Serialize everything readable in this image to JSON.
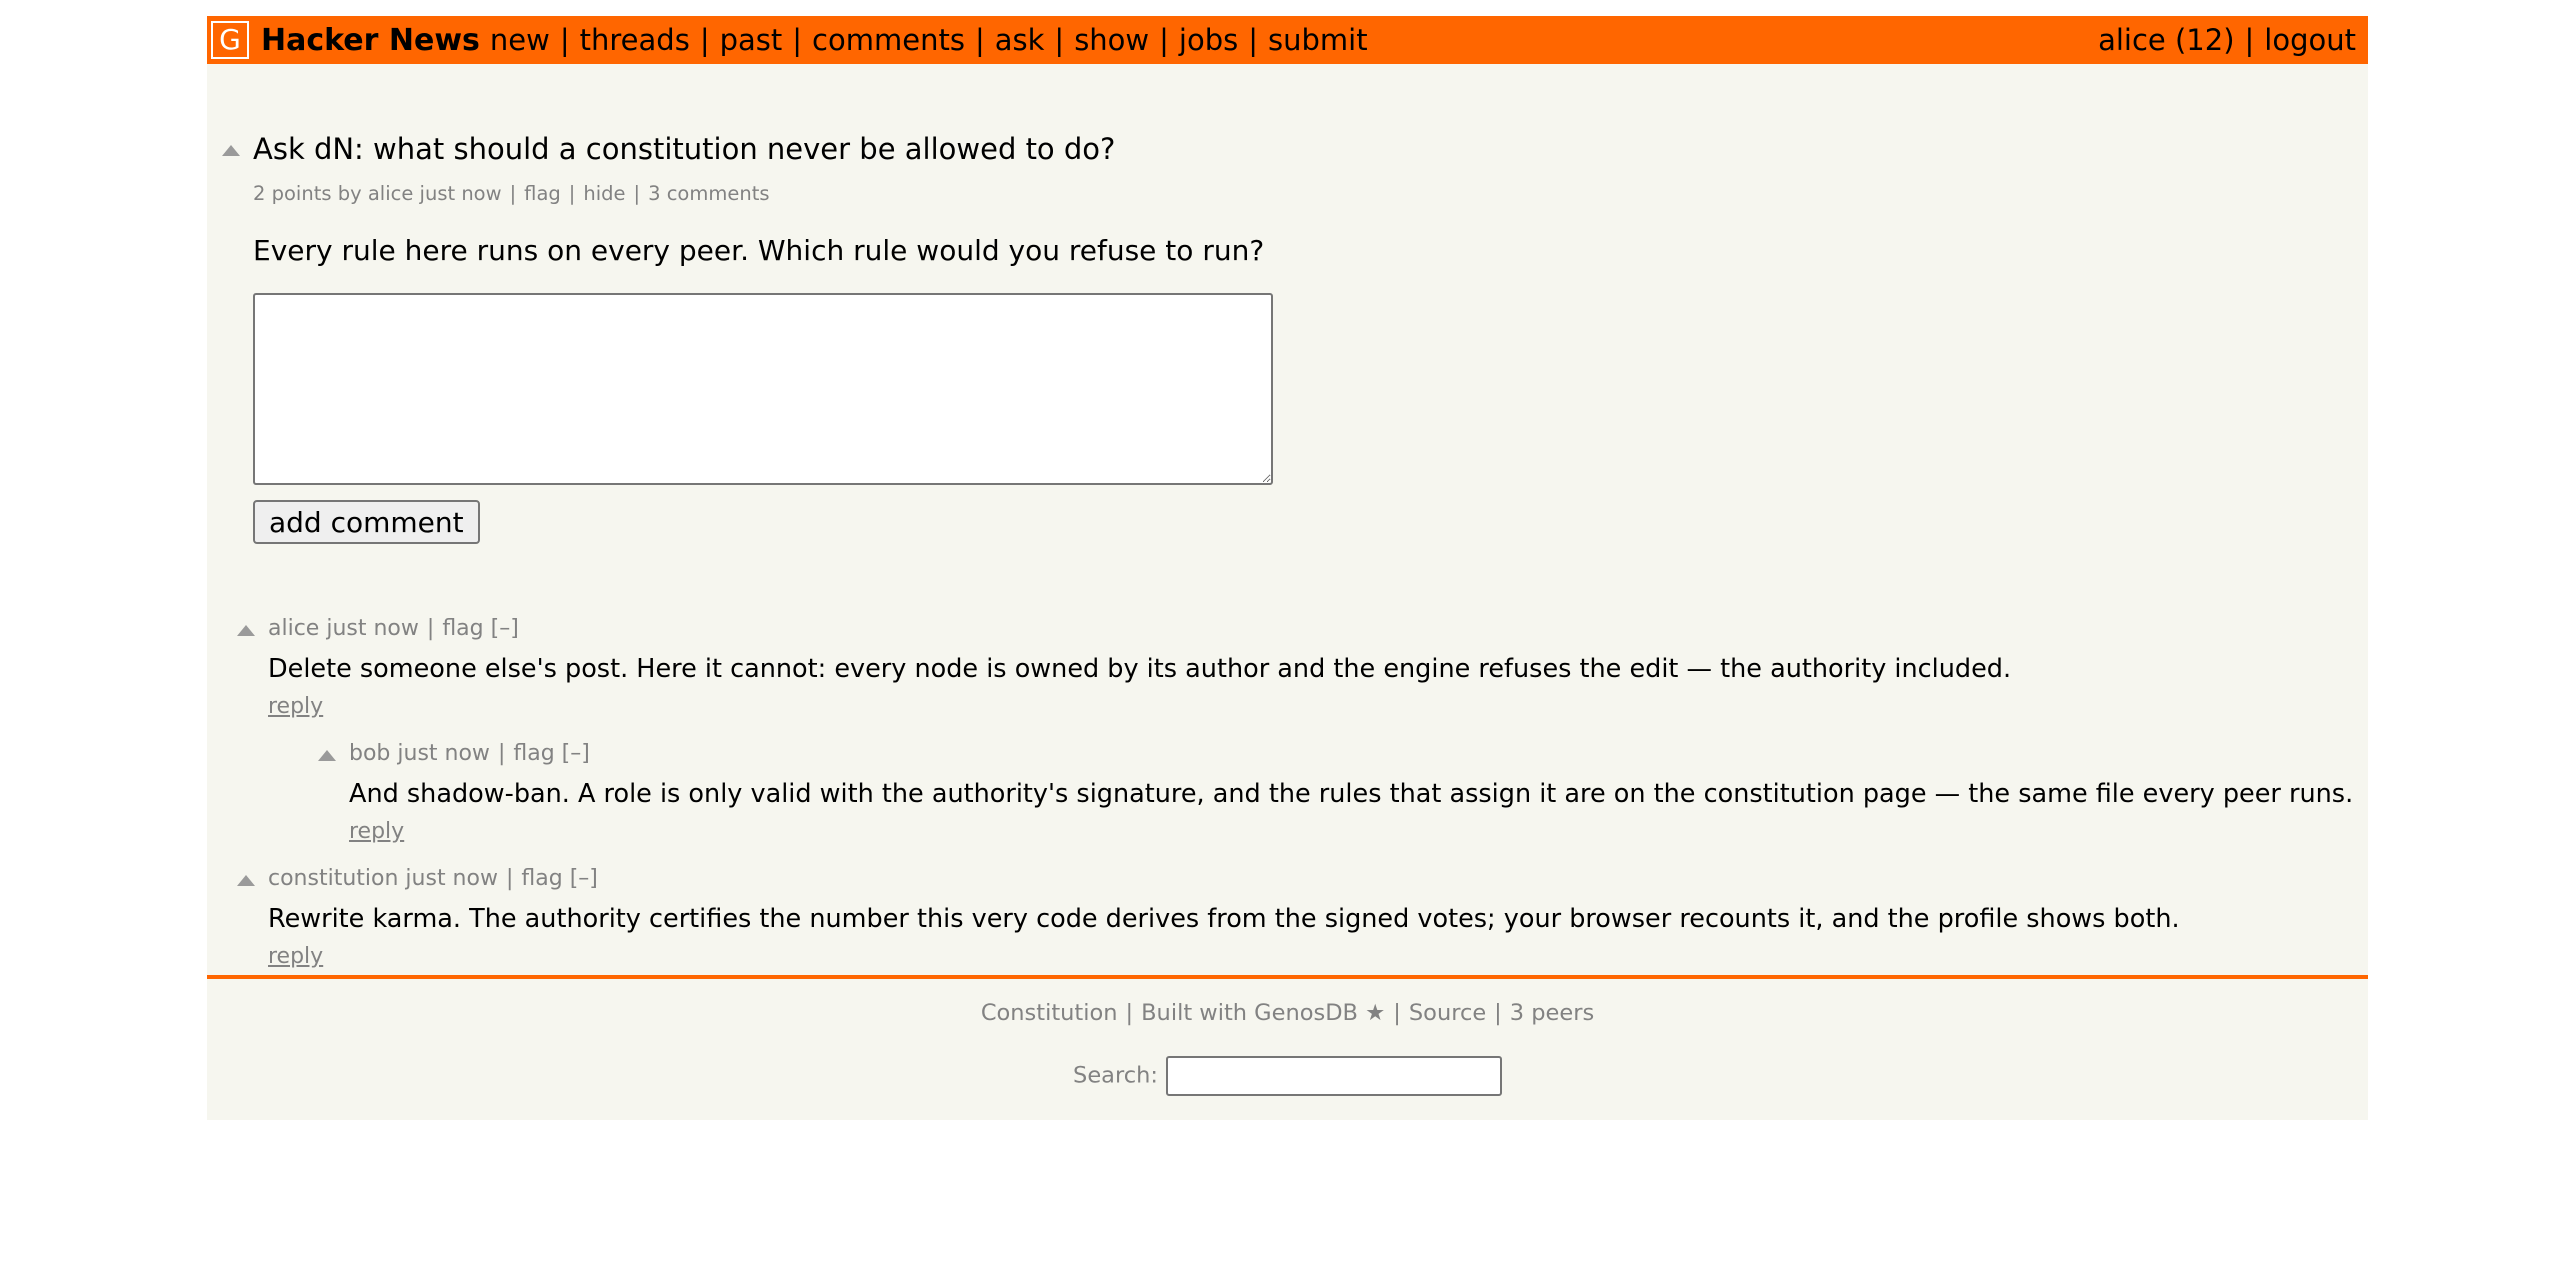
{
  "header": {
    "logo": "G",
    "brand": "Hacker News",
    "nav": [
      "new",
      "threads",
      "past",
      "comments",
      "ask",
      "show",
      "jobs",
      "submit"
    ],
    "user": "alice (12)",
    "logout": "logout",
    "separator": "|",
    "accent_color": "#ff6600"
  },
  "story": {
    "title": "Ask dN: what should a constitution never be allowed to do?",
    "points": "2 points",
    "by": "by",
    "author": "alice",
    "age": "just now",
    "flag": "flag",
    "hide": "hide",
    "comments": "3 comments",
    "text": "Every rule here runs on every peer. Which rule would you refuse to run?"
  },
  "reply_form": {
    "textarea_value": "",
    "submit_label": "add comment"
  },
  "comments": [
    {
      "author": "alice",
      "age": "just now",
      "flag": "flag",
      "toggle": "[–]",
      "text": "Delete someone else's post. Here it cannot: every node is owned by its author and the engine refuses the edit — the authority included.",
      "reply": "reply",
      "depth": 0
    },
    {
      "author": "bob",
      "age": "just now",
      "flag": "flag",
      "toggle": "[–]",
      "text": "And shadow-ban. A role is only valid with the authority's signature, and the rules that assign it are on the constitution page — the same file every peer runs.",
      "reply": "reply",
      "depth": 1
    },
    {
      "author": "constitution",
      "age": "just now",
      "flag": "flag",
      "toggle": "[–]",
      "text": "Rewrite karma. The authority certifies the number this very code derives from the signed votes; your browser recounts it, and the profile shows both.",
      "reply": "reply",
      "depth": 0
    }
  ],
  "footer": {
    "links": [
      "Constitution",
      "Built with GenosDB ★",
      "Source",
      "3 peers"
    ],
    "search_label": "Search:",
    "search_value": ""
  }
}
